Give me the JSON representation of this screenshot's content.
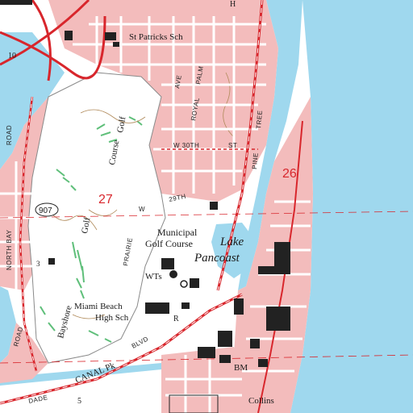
{
  "map": {
    "colors": {
      "water": "#9fd8ee",
      "urban": "#f3bcbc",
      "park": "#ffffff",
      "road": "#ffffff",
      "road_edge": "#8a8a8a",
      "highway": "#d8262c",
      "contour": "#b08a5a",
      "vegetation": "#5fbf7a",
      "building": "#222222",
      "grid": "#d8262c"
    },
    "labels": {
      "sch_top": "St Patricks Sch",
      "golf": "Golf",
      "course": "Course",
      "golf2": "Golf",
      "municipal": "Municipal",
      "golf_course": "Golf Course",
      "lake": "Lake",
      "pancoast": "Pancoast",
      "wts": "WTs",
      "miami_beach": "Miami Beach",
      "high_sch": "High Sch",
      "bm": "BM",
      "collins": "Collins",
      "bayshore": "Bayshore",
      "north_bay": "NORTH BAY",
      "road_left": "ROAD",
      "road_bottom": "ROAD",
      "dade": "DADE",
      "canal_pk": "CANAL Pk",
      "blvd": "BLVD",
      "prairie": "PRAIRIE",
      "ave": "AVE",
      "royal": "ROYAL",
      "palm": "PALM",
      "pine": "PINE",
      "tree": "TREE",
      "w30th": "W 30TH",
      "st": "ST",
      "w29th": "29TH",
      "w": "W",
      "r": "R",
      "sec27_a": "27",
      "sec26": "26",
      "sec10": "10",
      "sec5": "5",
      "sec3": "3",
      "route907": "907",
      "st_top": "St",
      "mark_h": "H"
    }
  }
}
